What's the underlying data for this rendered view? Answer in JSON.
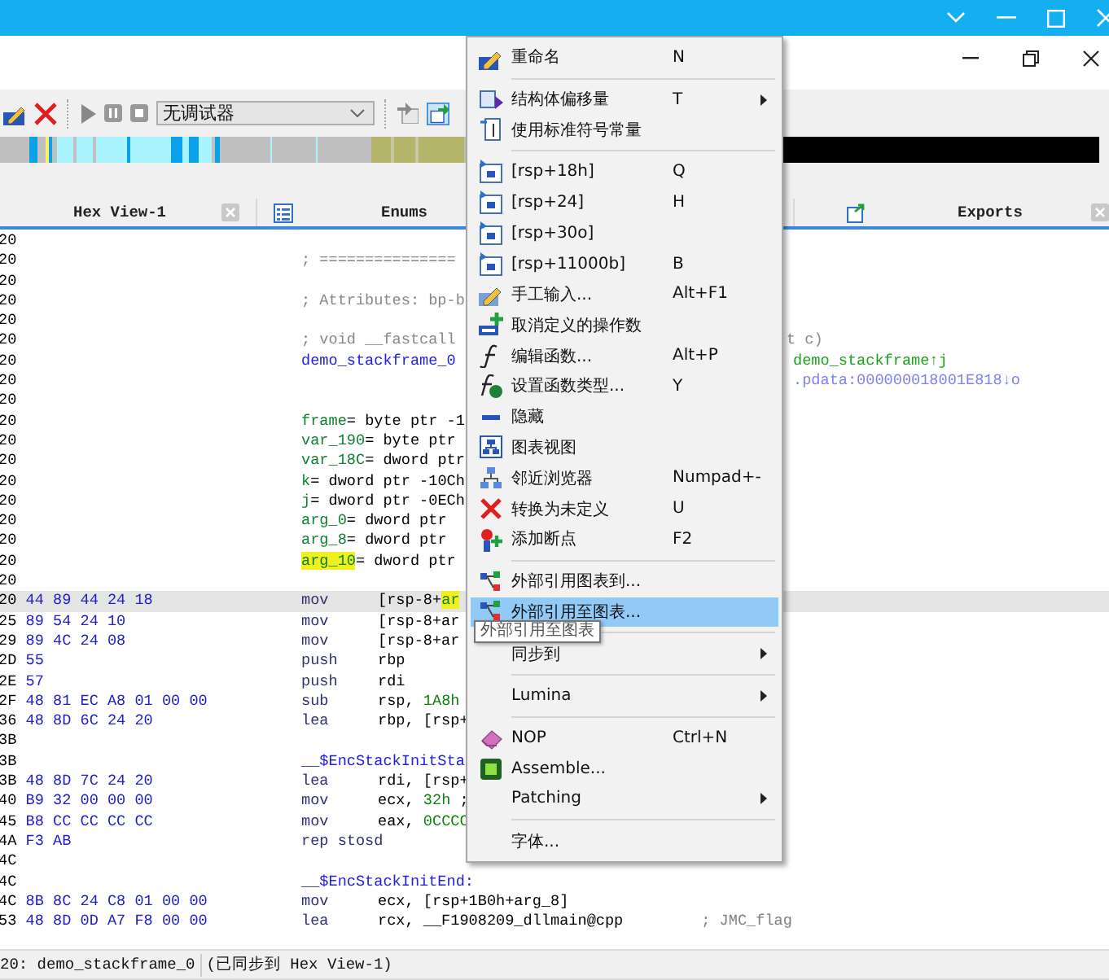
{
  "toolbar": {
    "debugger_select": {
      "value": "无调试器"
    }
  },
  "tabs": [
    {
      "label": "Hex View-1"
    },
    {
      "label": "Enums"
    },
    {
      "label": "Exports"
    }
  ],
  "code": {
    "lines": [
      {
        "kind": "blank",
        "addr": "20",
        "selected": false
      },
      {
        "kind": "comment",
        "addr": "20",
        "text": "; ===============",
        "selected": false
      },
      {
        "kind": "blank",
        "addr": "20",
        "selected": false
      },
      {
        "kind": "comment",
        "addr": "20",
        "text": "; Attributes: bp-b",
        "selected": false
      },
      {
        "kind": "blank",
        "addr": "20",
        "selected": false
      },
      {
        "kind": "comment",
        "addr": "20",
        "text": "; void __fastcall",
        "right": {
          "kind": "comment",
          "text": "t c)"
        },
        "selected": false
      },
      {
        "kind": "label",
        "addr": "20",
        "text": "demo_stackframe_0",
        "right": {
          "kind": "code",
          "text": "demo_stackframe↑j"
        },
        "selected": false
      },
      {
        "kind": "blank",
        "addr": "20",
        "right": {
          "kind": "data",
          "text": ".pdata:000000018001E818↓o"
        },
        "selected": false
      },
      {
        "kind": "blank",
        "addr": "20",
        "selected": false
      },
      {
        "kind": "var",
        "addr": "20",
        "name": "frame",
        "rest": "= byte ptr -1",
        "highlighted": false,
        "selected": false
      },
      {
        "kind": "var",
        "addr": "20",
        "name": "var_190",
        "rest": "= byte ptr",
        "highlighted": false,
        "selected": false
      },
      {
        "kind": "var",
        "addr": "20",
        "name": "var_18C",
        "rest": "= dword ptr",
        "highlighted": false,
        "selected": false
      },
      {
        "kind": "var",
        "addr": "20",
        "name": "k",
        "rest": "= dword ptr -10Ch",
        "highlighted": false,
        "selected": false
      },
      {
        "kind": "var",
        "addr": "20",
        "name": "j",
        "rest": "= dword ptr -0ECh",
        "highlighted": false,
        "selected": false
      },
      {
        "kind": "var",
        "addr": "20",
        "name": "arg_0",
        "rest": "= dword ptr",
        "highlighted": false,
        "selected": false
      },
      {
        "kind": "var",
        "addr": "20",
        "name": "arg_8",
        "rest": "= dword ptr",
        "highlighted": false,
        "selected": false
      },
      {
        "kind": "var",
        "addr": "20",
        "name": "arg_10",
        "rest": "= dword ptr",
        "highlighted": true,
        "selected": false
      },
      {
        "kind": "blank",
        "addr": "20",
        "selected": false
      },
      {
        "kind": "insn",
        "addr": "20",
        "bytes": "44 89 44 24 18",
        "mnem": "mov",
        "ops": [
          {
            "kind": "plain",
            "text": "[rsp-8+"
          },
          {
            "kind": "highlight",
            "text": "ar"
          }
        ],
        "selected": true
      },
      {
        "kind": "insn",
        "addr": "25",
        "bytes": "89 54 24 10",
        "mnem": "mov",
        "ops": [
          {
            "kind": "plain",
            "text": "[rsp-8+ar"
          }
        ],
        "selected": false
      },
      {
        "kind": "insn",
        "addr": "29",
        "bytes": "89 4C 24 08",
        "mnem": "mov",
        "ops": [
          {
            "kind": "plain",
            "text": "[rsp-8+ar"
          }
        ],
        "selected": false
      },
      {
        "kind": "insn",
        "addr": "2D",
        "bytes": "55",
        "mnem": "push",
        "ops": [
          {
            "kind": "plain",
            "text": "rbp"
          }
        ],
        "selected": false
      },
      {
        "kind": "insn",
        "addr": "2E",
        "bytes": "57",
        "mnem": "push",
        "ops": [
          {
            "kind": "plain",
            "text": "rdi"
          }
        ],
        "selected": false
      },
      {
        "kind": "insn",
        "addr": "2F",
        "bytes": "48 81 EC A8 01 00 00",
        "mnem": "sub",
        "ops": [
          {
            "kind": "plain",
            "text": "rsp, "
          },
          {
            "kind": "number",
            "text": "1A8h"
          }
        ],
        "selected": false
      },
      {
        "kind": "insn",
        "addr": "36",
        "bytes": "48 8D 6C 24 20",
        "mnem": "lea",
        "ops": [
          {
            "kind": "plain",
            "text": "rbp, [rsp+"
          }
        ],
        "selected": false
      },
      {
        "kind": "blank",
        "addr": "3B",
        "selected": false
      },
      {
        "kind": "label",
        "addr": "3B",
        "text": "__$EncStackInitSta",
        "selected": false
      },
      {
        "kind": "insn",
        "addr": "3B",
        "bytes": "48 8D 7C 24 20",
        "mnem": "lea",
        "ops": [
          {
            "kind": "plain",
            "text": "rdi, [rsp+"
          }
        ],
        "selected": false
      },
      {
        "kind": "insn",
        "addr": "40",
        "bytes": "B9 32 00 00 00",
        "mnem": "mov",
        "ops": [
          {
            "kind": "plain",
            "text": "ecx, "
          },
          {
            "kind": "number",
            "text": "32h"
          },
          {
            "kind": "plain",
            "text": " ;"
          }
        ],
        "selected": false
      },
      {
        "kind": "insn",
        "addr": "45",
        "bytes": "B8 CC CC CC CC",
        "mnem": "mov",
        "ops": [
          {
            "kind": "plain",
            "text": "eax, "
          },
          {
            "kind": "number",
            "text": "0CCCC"
          }
        ],
        "selected": false
      },
      {
        "kind": "insn",
        "addr": "4A",
        "bytes": "F3 AB",
        "mnem": "rep stosd",
        "selected": false
      },
      {
        "kind": "blank",
        "addr": "4C",
        "selected": false
      },
      {
        "kind": "label",
        "addr": "4C",
        "text": "__$EncStackInitEnd:",
        "selected": false
      },
      {
        "kind": "insn",
        "addr": "4C",
        "bytes": "8B 8C 24 C8 01 00 00",
        "mnem": "mov",
        "ops": [
          {
            "kind": "plain",
            "text": "ecx, [rsp+1B0h+arg_8]"
          }
        ],
        "selected": false
      },
      {
        "kind": "insn",
        "addr": "53",
        "bytes": "48 8D 0D A7 F8 00 00",
        "mnem": "lea",
        "ops": [
          {
            "kind": "plain",
            "text": "rcx, __F1908209_dllmain@cpp"
          },
          {
            "kind": "comment",
            "text": "; JMC_flag"
          }
        ],
        "selected": false
      }
    ]
  },
  "status_bar": {
    "location": "20: demo_stackframe_0",
    "sync": "(已同步到 Hex View-1)"
  },
  "context_menu": {
    "items": [
      {
        "kind": "item",
        "label": "重命名",
        "shortcut": "N",
        "submenu": false,
        "selected": false
      },
      {
        "kind": "separator"
      },
      {
        "kind": "item",
        "label": "结构体偏移量",
        "shortcut": "T",
        "submenu": true,
        "selected": false
      },
      {
        "kind": "item",
        "label": "使用标准符号常量",
        "submenu": false,
        "selected": false
      },
      {
        "kind": "separator"
      },
      {
        "kind": "item",
        "label": "[rsp+18h]",
        "shortcut": "Q",
        "submenu": false,
        "selected": false
      },
      {
        "kind": "item",
        "label": "[rsp+24]",
        "shortcut": "H",
        "submenu": false,
        "selected": false
      },
      {
        "kind": "item",
        "label": "[rsp+30o]",
        "submenu": false,
        "selected": false
      },
      {
        "kind": "item",
        "label": "[rsp+11000b]",
        "shortcut": "B",
        "submenu": false,
        "selected": false
      },
      {
        "kind": "item",
        "label": "手工输入...",
        "shortcut": "Alt+F1",
        "submenu": false,
        "selected": false
      },
      {
        "kind": "item",
        "label": "取消定义的操作数",
        "submenu": false,
        "selected": false
      },
      {
        "kind": "item",
        "label": "编辑函数...",
        "shortcut": "Alt+P",
        "submenu": false,
        "selected": false
      },
      {
        "kind": "item",
        "label": "设置函数类型...",
        "shortcut": "Y",
        "submenu": false,
        "selected": false
      },
      {
        "kind": "item",
        "label": "隐藏",
        "submenu": false,
        "selected": false
      },
      {
        "kind": "item",
        "label": "图表视图",
        "submenu": false,
        "selected": false
      },
      {
        "kind": "item",
        "label": "邻近浏览器",
        "shortcut": "Numpad+-",
        "submenu": false,
        "selected": false
      },
      {
        "kind": "item",
        "label": "转换为未定义",
        "shortcut": "U",
        "submenu": false,
        "selected": false
      },
      {
        "kind": "item",
        "label": "添加断点",
        "shortcut": "F2",
        "submenu": false,
        "selected": false
      },
      {
        "kind": "separator"
      },
      {
        "kind": "item",
        "label": "外部引用图表到...",
        "submenu": false,
        "selected": false
      },
      {
        "kind": "item",
        "label": "外部引用至图表...",
        "submenu": false,
        "selected": true
      },
      {
        "kind": "separator"
      },
      {
        "kind": "item",
        "label": "同步到",
        "submenu": true,
        "selected": false
      },
      {
        "kind": "separator"
      },
      {
        "kind": "item",
        "label": "Lumina",
        "submenu": true,
        "selected": false
      },
      {
        "kind": "separator"
      },
      {
        "kind": "item",
        "label": "NOP",
        "shortcut": "Ctrl+N",
        "submenu": false,
        "selected": false
      },
      {
        "kind": "item",
        "label": "Assemble...",
        "submenu": false,
        "selected": false
      },
      {
        "kind": "item",
        "label": "Patching",
        "submenu": true,
        "selected": false
      },
      {
        "kind": "separator"
      },
      {
        "kind": "item",
        "label": "字体...",
        "submenu": false,
        "selected": false
      }
    ]
  },
  "tooltip": {
    "text": "外部引用至图表"
  }
}
